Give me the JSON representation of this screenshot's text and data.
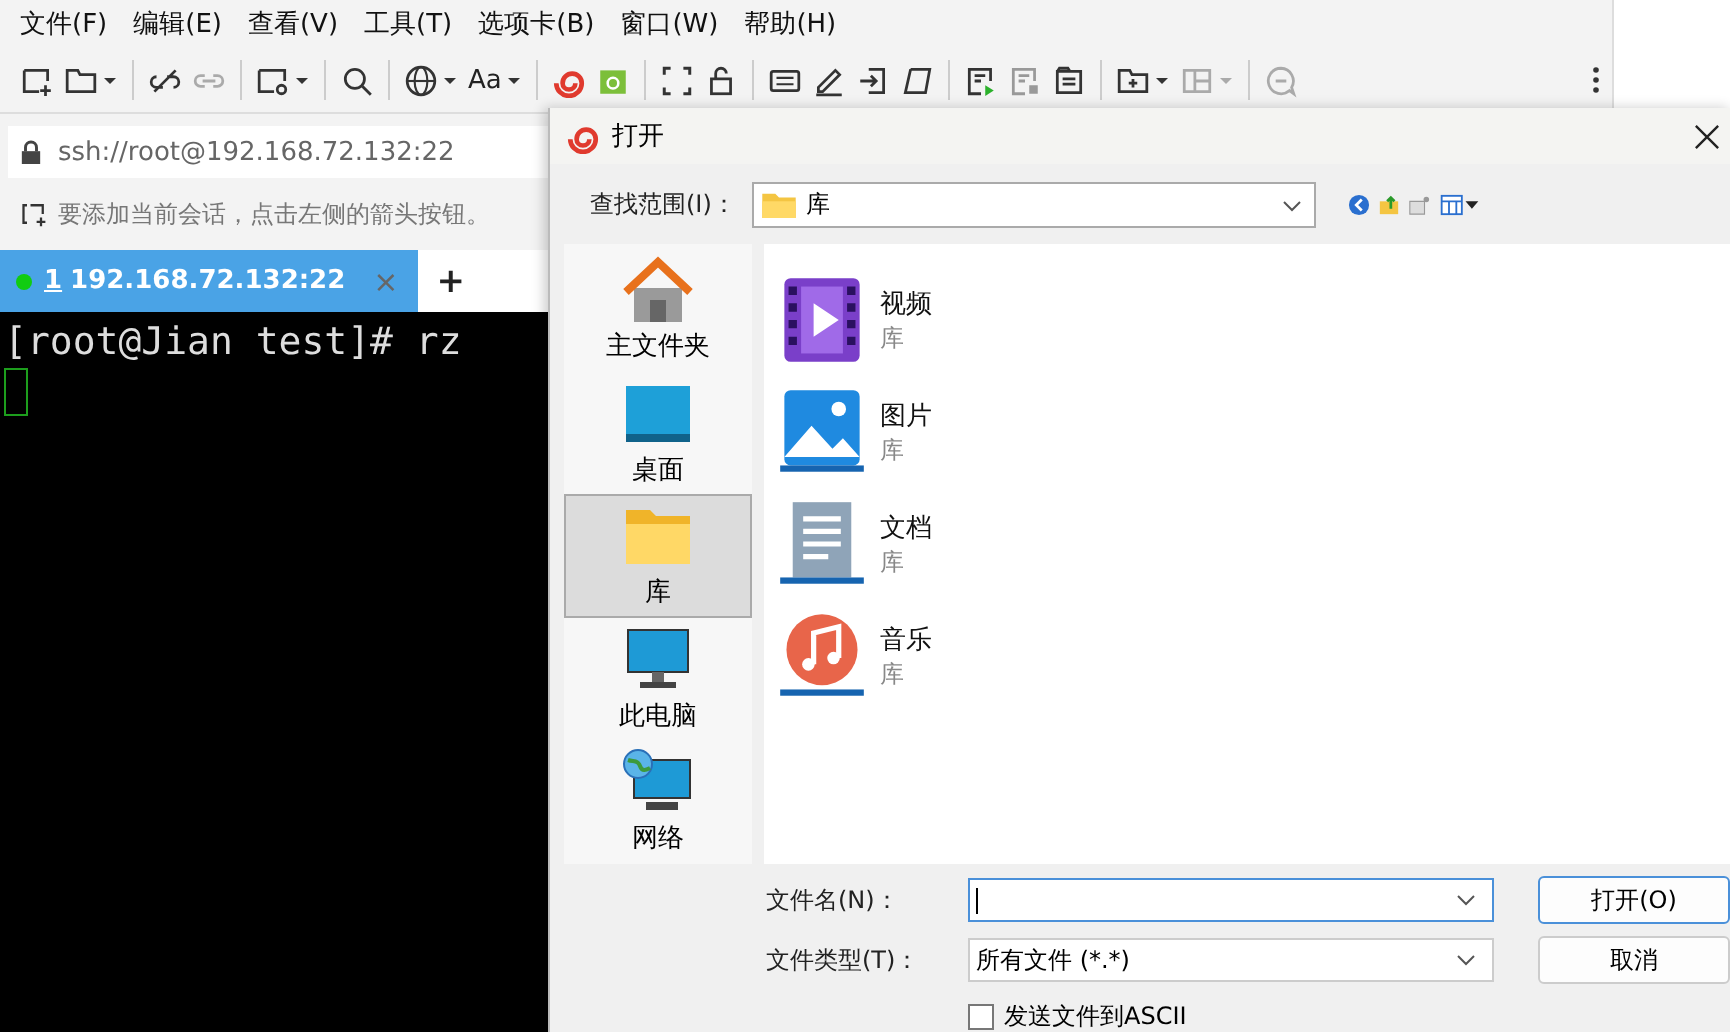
{
  "menu": [
    "文件(F)",
    "编辑(E)",
    "查看(V)",
    "工具(T)",
    "选项卡(B)",
    "窗口(W)",
    "帮助(H)"
  ],
  "toolbar": {
    "font_button": "Aa"
  },
  "address": "ssh://root@192.168.72.132:22",
  "hint": "要添加当前会话，点击左侧的箭头按钮。",
  "tabs": [
    {
      "index": "1",
      "label": "192.168.72.132:22",
      "close": "×",
      "selected": true,
      "connected": true
    }
  ],
  "new_tab": "+",
  "terminal": {
    "lines": [
      "[root@Jian test]# rz"
    ]
  },
  "dialog": {
    "title": "打开",
    "look_in_label": "查找范围(I)：",
    "look_in": "库",
    "places": [
      {
        "label": "主文件夹",
        "kind": "home",
        "selected": false
      },
      {
        "label": "桌面",
        "kind": "desktop",
        "selected": false
      },
      {
        "label": "库",
        "kind": "library",
        "selected": true
      },
      {
        "label": "此电脑",
        "kind": "computer",
        "selected": false
      },
      {
        "label": "网络",
        "kind": "network",
        "selected": false
      }
    ],
    "files": [
      {
        "name": "视频",
        "type": "库",
        "kind": "video"
      },
      {
        "name": "图片",
        "type": "库",
        "kind": "pictures"
      },
      {
        "name": "文档",
        "type": "库",
        "kind": "documents"
      },
      {
        "name": "音乐",
        "type": "库",
        "kind": "music"
      }
    ],
    "file_name_label": "文件名(N)：",
    "file_type_label": "文件类型(T)：",
    "file_type": "所有文件 (*.*)",
    "buttons": [
      {
        "label": "打开(O)",
        "default": true
      },
      {
        "label": "取消",
        "default": false
      }
    ],
    "checkbox": {
      "label": "发送文件到ASCII",
      "checked": false
    }
  }
}
